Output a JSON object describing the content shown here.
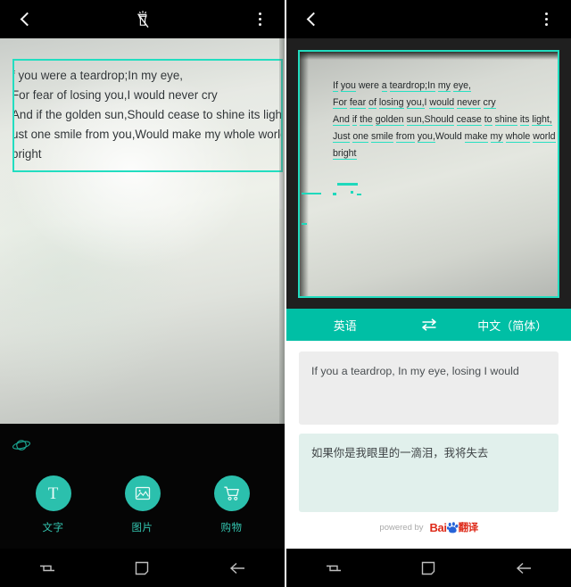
{
  "app": {
    "accent_teal": "#2bc0ad",
    "accent_bar_teal": "#00bfa5",
    "ocr_border": "#22ddc0",
    "topbar_bg": "#000000"
  },
  "left_panel": {
    "topbar": {
      "back_label": "‹",
      "flash_icon": "flashlight-off-icon",
      "more_label": "⋮"
    },
    "ocr_overlay": {
      "lines": [
        "f you were a teardrop;In my eye,",
        "For fear of losing you,I would never cry",
        "And if the golden sun,Should cease to shine its light,",
        "ust one smile from you,Would make my whole world",
        "bright"
      ]
    },
    "tools": {
      "globe_icon": "globe-icon",
      "actions": [
        {
          "icon": "text-icon",
          "glyph": "T",
          "label": "文字"
        },
        {
          "icon": "image-icon",
          "glyph": "",
          "label": "图片"
        },
        {
          "icon": "cart-icon",
          "glyph": "",
          "label": "购物"
        }
      ]
    },
    "navbar": {
      "recents_icon": "recents-icon",
      "home_icon": "home-icon",
      "back_icon": "back-arrow-icon"
    }
  },
  "right_panel": {
    "topbar": {
      "back_label": "‹",
      "more_label": "⋮"
    },
    "photo": {
      "lines": [
        [
          "If",
          " ",
          "you",
          " ",
          "were",
          " ",
          "a",
          " ",
          "teardrop;",
          "In",
          " ",
          "my",
          " ",
          "eye,"
        ],
        [
          "For",
          " ",
          "fear",
          " ",
          "of",
          " ",
          "losing",
          " ",
          "you,",
          "I",
          " ",
          "would",
          " ",
          "never",
          " ",
          "cry"
        ],
        [
          "And",
          " ",
          "if",
          " ",
          "the",
          " ",
          "golden",
          " ",
          "sun,",
          "Should",
          " ",
          "cease",
          " ",
          "to",
          " ",
          "shine",
          " ",
          "its",
          " ",
          "light,"
        ],
        [
          "Just",
          " ",
          "one",
          " ",
          "smile",
          " ",
          "from",
          " ",
          "you,",
          "Would",
          " ",
          "make",
          " ",
          "my",
          " ",
          "whole",
          " ",
          "world"
        ],
        [
          "bright"
        ]
      ],
      "line1": "If you were a teardrop;In my eye,",
      "line2": "For fear of losing you,I would never cry",
      "line3": "And if the golden sun,Should cease to shine its light,",
      "line4": "Just one smile from you,Would make my whole world",
      "line5": "bright"
    },
    "language_bar": {
      "source_language": "英语",
      "swap_icon": "swap-arrows-icon",
      "target_language": "中文（简体）"
    },
    "result": {
      "source_text": "If you a teardrop, In my eye, losing I would",
      "translated_text": "如果你是我眼里的一滴泪，我将失去",
      "powered_by_label": "powered by",
      "brand_latin": "Bai",
      "brand_cjk": "翻译"
    },
    "navbar": {
      "recents_icon": "recents-icon",
      "home_icon": "home-icon",
      "back_icon": "back-arrow-icon"
    }
  }
}
